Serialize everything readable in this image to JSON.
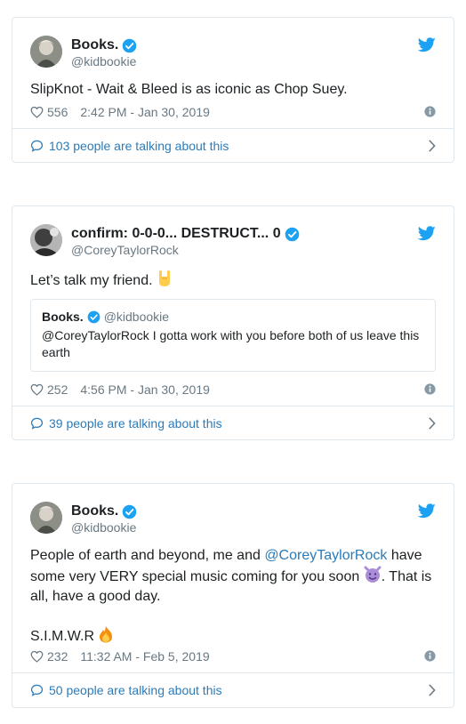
{
  "tweets": [
    {
      "name": "Books.",
      "handle": "@kidbookie",
      "text": "SlipKnot - Wait & Bleed is as iconic as Chop Suey.",
      "likes": "556",
      "time": "2:42 PM - Jan 30, 2019",
      "talking": "103 people are talking about this"
    },
    {
      "name": "confirm: 0-0-0... DESTRUCT... 0",
      "handle": "@CoreyTaylorRock",
      "text": "Let’s talk my friend.",
      "quote": {
        "name": "Books.",
        "handle": "@kidbookie",
        "text": "@CoreyTaylorRock I gotta work with you before both of us leave this earth"
      },
      "likes": "252",
      "time": "4:56 PM - Jan 30, 2019",
      "talking": "39 people are talking about this"
    },
    {
      "name": "Books.",
      "handle": "@kidbookie",
      "text_part1": "People of earth and beyond, me and ",
      "mention": "@CoreyTaylorRock",
      "text_part2": " have some very VERY special music coming for you soon ",
      "text_part3": ". That is all, have a good day.",
      "text_line2": "S.I.M.W.R",
      "likes": "232",
      "time": "11:32 AM - Feb 5, 2019",
      "talking": "50 people are talking about this"
    }
  ],
  "icons": {
    "verified": "verified-badge",
    "bird": "twitter-bird-icon",
    "heart": "heart-icon",
    "info": "info-icon",
    "talk": "speech-bubble-icon",
    "chevron": "chevron-right-icon"
  },
  "colors": {
    "link": "#2b7bb9",
    "twitter_blue": "#1da1f2",
    "secondary_text": "#697882",
    "border": "#e1e8ed"
  }
}
